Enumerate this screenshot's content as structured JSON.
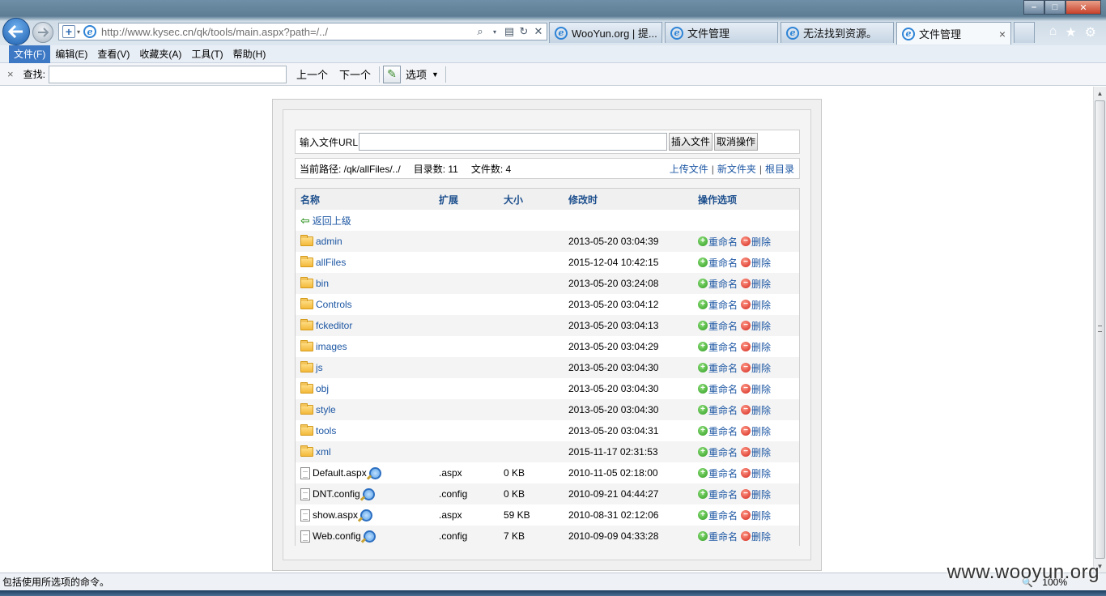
{
  "browser": {
    "url_host": "http://www.kysec.cn",
    "url_path": "/qk/tools/main.aspx?path=/../",
    "tabs": [
      {
        "label": "WooYun.org | 提..."
      },
      {
        "label": "文件管理"
      },
      {
        "label": "无法找到资源。"
      },
      {
        "label": "文件管理"
      }
    ],
    "window_controls": {
      "minimize": "–",
      "maximize": "□",
      "close": "✕"
    },
    "icons": {
      "home": "home-icon",
      "favorites": "star-icon",
      "tools": "gear-icon"
    }
  },
  "menu": {
    "items": [
      "文件(F)",
      "编辑(E)",
      "查看(V)",
      "收藏夹(A)",
      "工具(T)",
      "帮助(H)"
    ]
  },
  "findbar": {
    "close": "×",
    "label": "查找:",
    "input_value": "",
    "prev": "上一个",
    "next": "下一个",
    "options": "选项"
  },
  "page": {
    "url_label": "输入文件URL",
    "url_value": "",
    "insert_button": "插入文件",
    "cancel_button": "取消操作",
    "current_path_label": "当前路径: /qk/allFiles/../",
    "dir_count_label": "目录数: 11",
    "file_count_label": "文件数: 4",
    "upload_link": "上传文件",
    "new_folder_link": "新文件夹",
    "root_link": "根目录",
    "columns": {
      "name": "名称",
      "ext": "扩展",
      "size": "大小",
      "modified": "修改时",
      "ops": "操作选项"
    },
    "back_link": "返回上级",
    "rename_label": "重命名",
    "delete_label": "删除",
    "folders": [
      {
        "name": "admin",
        "modified": "2013-05-20 03:04:39"
      },
      {
        "name": "allFiles",
        "modified": "2015-12-04 10:42:15"
      },
      {
        "name": "bin",
        "modified": "2013-05-20 03:24:08"
      },
      {
        "name": "Controls",
        "modified": "2013-05-20 03:04:12"
      },
      {
        "name": "fckeditor",
        "modified": "2013-05-20 03:04:13"
      },
      {
        "name": "images",
        "modified": "2013-05-20 03:04:29"
      },
      {
        "name": "js",
        "modified": "2013-05-20 03:04:30"
      },
      {
        "name": "obj",
        "modified": "2013-05-20 03:04:30"
      },
      {
        "name": "style",
        "modified": "2013-05-20 03:04:30"
      },
      {
        "name": "tools",
        "modified": "2013-05-20 03:04:31"
      },
      {
        "name": "xml",
        "modified": "2015-11-17 02:31:53"
      }
    ],
    "files": [
      {
        "name": "Default.aspx",
        "ext": ".aspx",
        "size": "0 KB",
        "modified": "2010-11-05 02:18:00"
      },
      {
        "name": "DNT.config",
        "ext": ".config",
        "size": "0 KB",
        "modified": "2010-09-21 04:44:27"
      },
      {
        "name": "show.aspx",
        "ext": ".aspx",
        "size": "59 KB",
        "modified": "2010-08-31 02:12:06"
      },
      {
        "name": "Web.config",
        "ext": ".config",
        "size": "7 KB",
        "modified": "2010-09-09 04:33:28"
      }
    ]
  },
  "status": {
    "text": "包括使用所选项的命令。",
    "zoom": "100%"
  },
  "watermark": "www.wooyun.org"
}
